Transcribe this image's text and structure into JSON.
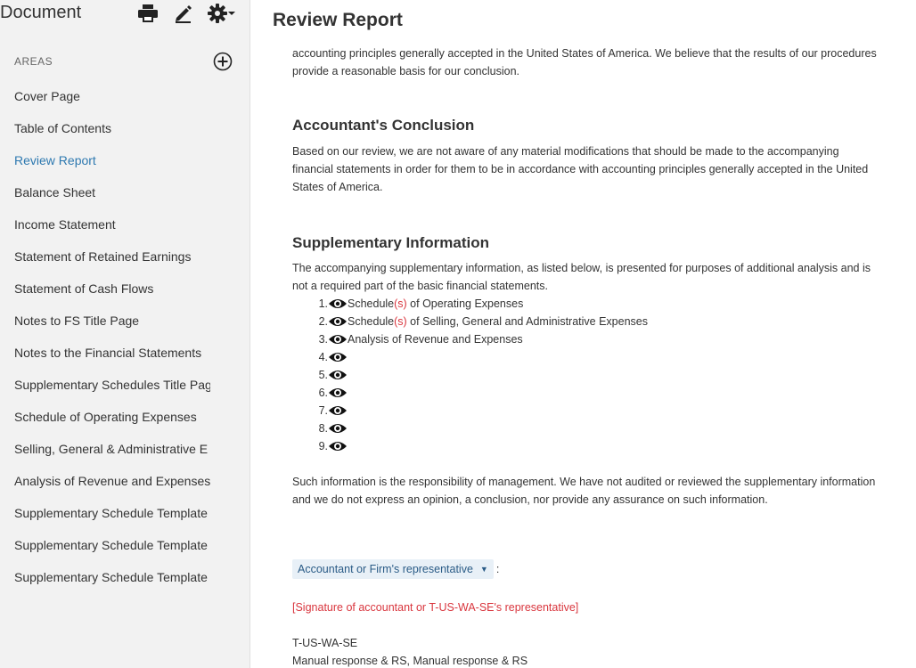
{
  "sidebar": {
    "title": "Document",
    "areas_label": "AREAS",
    "items": [
      {
        "label": "Cover Page"
      },
      {
        "label": "Table of Contents"
      },
      {
        "label": "Review Report"
      },
      {
        "label": "Balance Sheet"
      },
      {
        "label": "Income Statement"
      },
      {
        "label": "Statement of Retained Earnings"
      },
      {
        "label": "Statement of Cash Flows"
      },
      {
        "label": "Notes to FS Title Page"
      },
      {
        "label": "Notes to the Financial Statements"
      },
      {
        "label": "Supplementary Schedules Title Pag"
      },
      {
        "label": "Schedule of Operating Expenses"
      },
      {
        "label": "Selling, General & Administrative E"
      },
      {
        "label": "Analysis of Revenue and Expenses"
      },
      {
        "label": "Supplementary Schedule Template"
      },
      {
        "label": "Supplementary Schedule Template"
      },
      {
        "label": "Supplementary Schedule Template"
      }
    ],
    "active_item": "Review Report",
    "icons": [
      "print-icon",
      "edit-icon",
      "gear-icon",
      "add-circle-icon"
    ]
  },
  "main": {
    "title": "Review Report",
    "intro": "accounting principles generally accepted in the United States of America. We believe that the results of our procedures provide a reasonable basis for our conclusion.",
    "conclusion_heading": "Accountant's Conclusion",
    "conclusion_text": "Based on our review, we are not aware of any material modifications that should be made to the accompanying financial statements in order for them to be in accordance with accounting principles generally accepted in the United States of America.",
    "supp_heading": "Supplementary Information",
    "supp_text": "The accompanying supplementary information, as listed below, is presented for purposes of additional analysis and is not a required part of the basic financial statements.",
    "supp_list": [
      {
        "num": "1.",
        "pre": "Schedule",
        "mark": "(s)",
        "post": " of Operating Expenses"
      },
      {
        "num": "2.",
        "pre": "Schedule",
        "mark": "(s)",
        "post": " of Selling, General and Administrative Expenses"
      },
      {
        "num": "3.",
        "pre": "Analysis of Revenue and Expenses",
        "mark": "",
        "post": ""
      },
      {
        "num": "4.",
        "pre": "",
        "mark": "",
        "post": ""
      },
      {
        "num": "5.",
        "pre": "",
        "mark": "",
        "post": ""
      },
      {
        "num": "6.",
        "pre": "",
        "mark": "",
        "post": ""
      },
      {
        "num": "7.",
        "pre": "",
        "mark": "",
        "post": ""
      },
      {
        "num": "8.",
        "pre": "",
        "mark": "",
        "post": ""
      },
      {
        "num": "9.",
        "pre": "",
        "mark": "",
        "post": ""
      }
    ],
    "responsibility_text": "Such information is the responsibility of management. We have not audited or reviewed the supplementary information and we do not express an opinion, a conclusion, nor provide any assurance on such information.",
    "representative_select": "Accountant or Firm's representative",
    "colon": ":",
    "signature": "[Signature of accountant or T-US-WA-SE's representative]",
    "firm_name": "T-US-WA-SE",
    "firm_location": "Manual response & RS, Manual response & RS"
  },
  "colors": {
    "accent": "#2e79b0",
    "highlight": "#d9363e",
    "sidebar_bg": "#f2f2f2",
    "select_bg": "#e8f0f7"
  }
}
